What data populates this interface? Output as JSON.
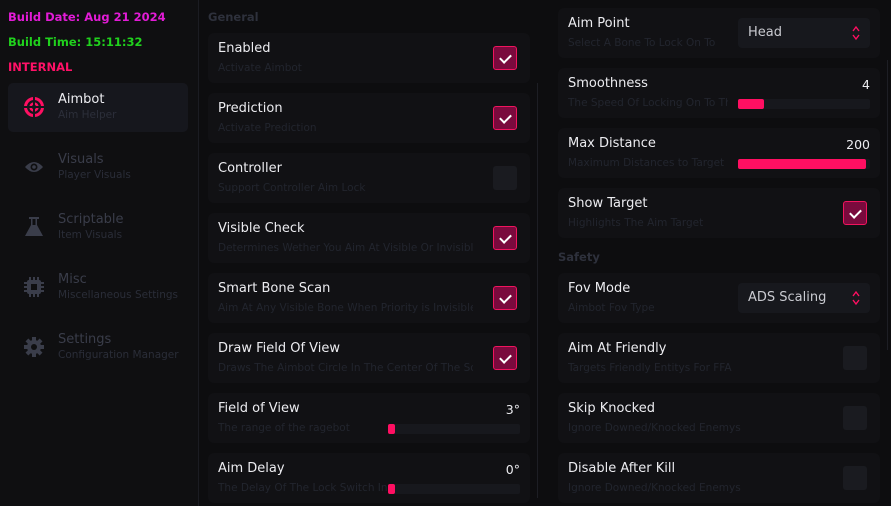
{
  "build": {
    "date": "Build Date: Aug 21 2024",
    "time": "Build Time: 15:11:32",
    "edition": "INTERNAL"
  },
  "colors": {
    "accent": "#ff0f62",
    "build_date": "#e21bd6",
    "build_time": "#20d11d"
  },
  "sidebar": {
    "items": [
      {
        "label": "Aimbot",
        "sub": "Aim Helper",
        "icon": "crosshair-icon",
        "active": true
      },
      {
        "label": "Visuals",
        "sub": "Player Visuals",
        "icon": "eye-icon",
        "active": false
      },
      {
        "label": "Scriptable",
        "sub": "Item Visuals",
        "icon": "flask-icon",
        "active": false
      },
      {
        "label": "Misc",
        "sub": "Miscellaneous Settings",
        "icon": "chip-icon",
        "active": false
      },
      {
        "label": "Settings",
        "sub": "Configuration Manager",
        "icon": "gear-icon",
        "active": false
      }
    ]
  },
  "general": {
    "title": "General",
    "rows": [
      {
        "label": "Enabled",
        "desc": "Activate Aimbot",
        "type": "checkbox",
        "checked": true
      },
      {
        "label": "Prediction",
        "desc": "Activate Prediction",
        "type": "checkbox",
        "checked": true
      },
      {
        "label": "Controller",
        "desc": "Support Controller Aim Lock",
        "type": "checkbox",
        "checked": false
      },
      {
        "label": "Visible Check",
        "desc": "Determines Wether You Aim At Visible Or Invisible",
        "type": "checkbox",
        "checked": true
      },
      {
        "label": "Smart Bone Scan",
        "desc": "Aim At Any Visible Bone When Priority is Invisible",
        "type": "checkbox",
        "checked": true
      },
      {
        "label": "Draw Field Of View",
        "desc": "Draws The Aimbot Circle In The Center Of The Screen",
        "type": "checkbox",
        "checked": true
      },
      {
        "label": "Field of View",
        "desc": "The range of the ragebot",
        "type": "slider",
        "value": "3°",
        "fraction": 0.03
      },
      {
        "label": "Aim Delay",
        "desc": "The Delay Of The Lock Switch In",
        "type": "slider",
        "value": "0°",
        "fraction": 0.0
      }
    ]
  },
  "right": {
    "rows": [
      {
        "label": "Aim Point",
        "desc": "Select A Bone To Lock On To",
        "type": "select",
        "value": "Head"
      },
      {
        "label": "Smoothness",
        "desc": "The Speed Of Locking On To The Target",
        "type": "slider",
        "value": "4",
        "fraction": 0.2
      },
      {
        "label": "Max Distance",
        "desc": "Maximum Distances to Target",
        "type": "slider",
        "value": "200",
        "fraction": 0.97
      },
      {
        "label": "Show Target",
        "desc": "Highlights The Aim Target",
        "type": "checkbox",
        "checked": true
      }
    ]
  },
  "safety": {
    "title": "Safety",
    "rows": [
      {
        "label": "Fov Mode",
        "desc": "Aimbot Fov Type",
        "type": "select",
        "value": "ADS Scaling"
      },
      {
        "label": "Aim At Friendly",
        "desc": "Targets Friendly Entitys For FFA",
        "type": "checkbox",
        "checked": false
      },
      {
        "label": "Skip Knocked",
        "desc": "Ignore Downed/Knocked Enemys",
        "type": "checkbox",
        "checked": false
      },
      {
        "label": "Disable After Kill",
        "desc": "Ignore Downed/Knocked Enemys",
        "type": "checkbox",
        "checked": false
      }
    ]
  }
}
